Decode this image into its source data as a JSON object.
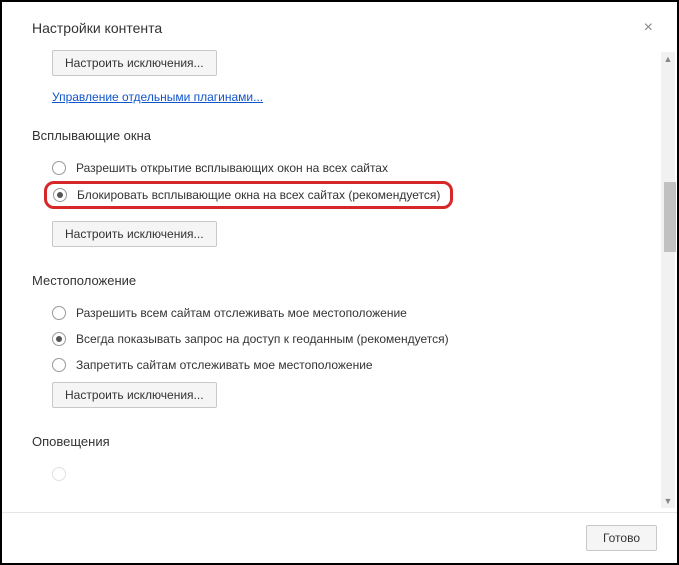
{
  "dialog": {
    "title": "Настройки контента",
    "done_label": "Готово"
  },
  "top": {
    "exceptions_btn": "Настроить исключения...",
    "plugins_link": "Управление отдельными плагинами..."
  },
  "popups": {
    "title": "Всплывающие окна",
    "allow_label": "Разрешить открытие всплывающих окон на всех сайтах",
    "block_label": "Блокировать всплывающие окна на всех сайтах (рекомендуется)",
    "exceptions_btn": "Настроить исключения..."
  },
  "location": {
    "title": "Местоположение",
    "allow_label": "Разрешить всем сайтам отслеживать мое местоположение",
    "ask_label": "Всегда показывать запрос на доступ к геоданным (рекомендуется)",
    "deny_label": "Запретить сайтам отслеживать мое местоположение",
    "exceptions_btn": "Настроить исключения..."
  },
  "notifications": {
    "title": "Оповещения"
  }
}
